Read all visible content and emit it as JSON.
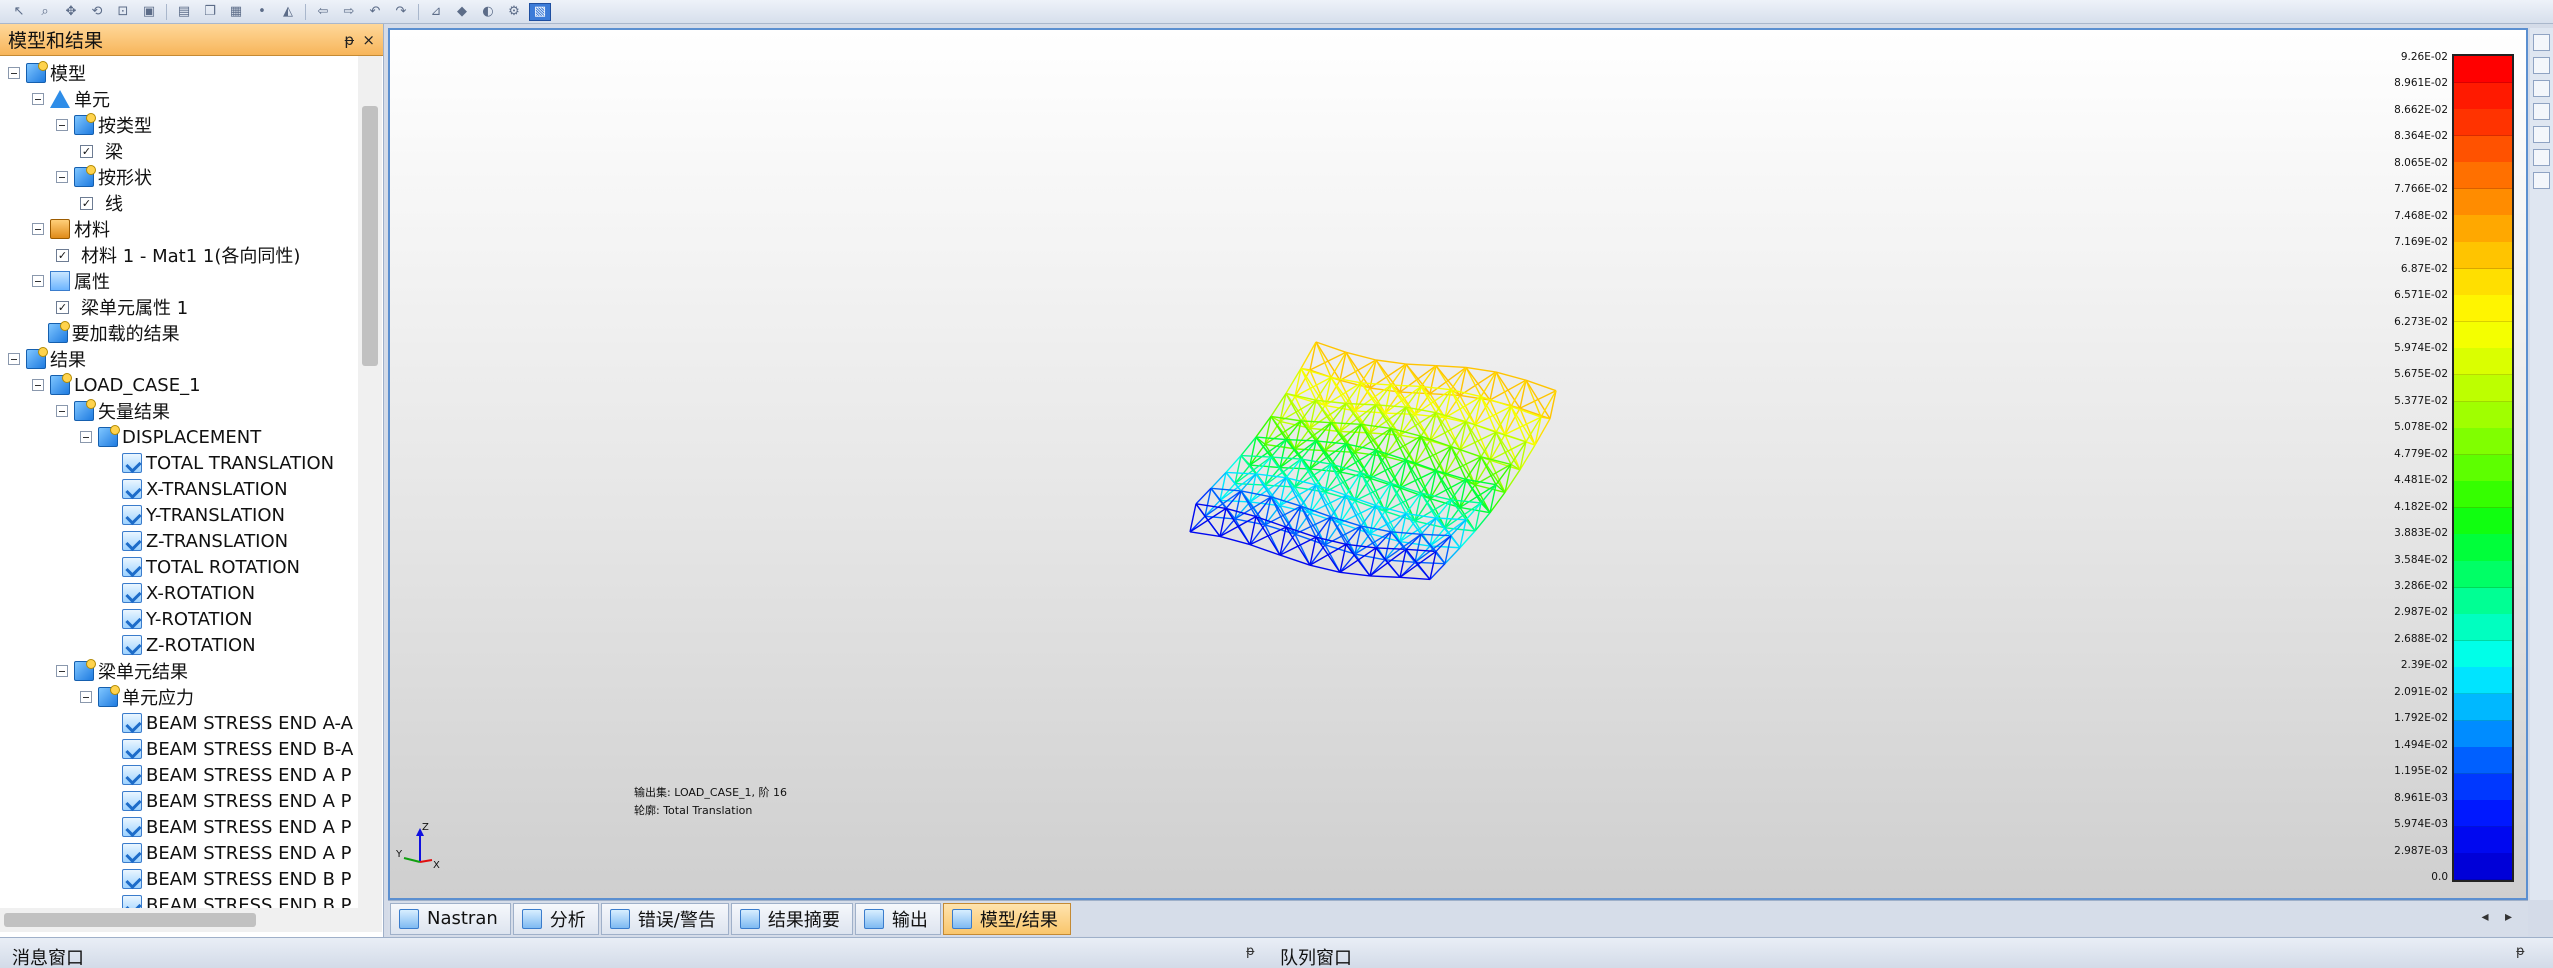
{
  "toolbar": {
    "icons": [
      "select-icon",
      "zoom-icon",
      "pan-icon",
      "rotate-icon",
      "fit-icon",
      "view-icon",
      "save-icon",
      "copy-icon",
      "mesh-icon",
      "node-icon",
      "element-icon",
      "arrow-left-icon",
      "arrow-right-icon",
      "undo-icon",
      "redo-icon",
      "measure-icon",
      "results-icon",
      "display-icon",
      "settings-icon",
      "active-view-icon"
    ]
  },
  "left_panel": {
    "title": "模型和结果",
    "pin_glyph": "ᵽ",
    "close_glyph": "×",
    "tree": [
      {
        "label": "模型",
        "level": 0,
        "icon": "folder",
        "expander": true
      },
      {
        "label": "单元",
        "level": 1,
        "icon": "element",
        "expander": true
      },
      {
        "label": "按类型",
        "level": 2,
        "icon": "folder",
        "expander": true
      },
      {
        "label": "梁",
        "level": 3,
        "icon": "none",
        "checkbox": true
      },
      {
        "label": "按形状",
        "level": 2,
        "icon": "folder",
        "expander": true
      },
      {
        "label": "线",
        "level": 3,
        "icon": "none",
        "checkbox": true
      },
      {
        "label": "材料",
        "level": 1,
        "icon": "mat",
        "expander": true
      },
      {
        "label": "材料 1 - Mat1 1(各向同性)",
        "level": 2,
        "icon": "none",
        "checkbox": true
      },
      {
        "label": "属性",
        "level": 1,
        "icon": "prop",
        "expander": true
      },
      {
        "label": "梁单元属性 1",
        "level": 2,
        "icon": "none",
        "checkbox": true
      },
      {
        "label": "要加载的结果",
        "level": 0.9,
        "icon": "folder",
        "expander": false
      },
      {
        "label": "结果",
        "level": 0,
        "icon": "folder",
        "expander": true
      },
      {
        "label": "LOAD_CASE_1",
        "level": 1,
        "icon": "folder",
        "expander": true
      },
      {
        "label": "矢量结果",
        "level": 2,
        "icon": "folder",
        "expander": true
      },
      {
        "label": "DISPLACEMENT",
        "level": 3,
        "icon": "folder",
        "expander": true
      },
      {
        "label": "TOTAL TRANSLATION",
        "level": 4,
        "icon": "result"
      },
      {
        "label": "X-TRANSLATION",
        "level": 4,
        "icon": "result"
      },
      {
        "label": "Y-TRANSLATION",
        "level": 4,
        "icon": "result"
      },
      {
        "label": "Z-TRANSLATION",
        "level": 4,
        "icon": "result"
      },
      {
        "label": "TOTAL ROTATION",
        "level": 4,
        "icon": "result"
      },
      {
        "label": "X-ROTATION",
        "level": 4,
        "icon": "result"
      },
      {
        "label": "Y-ROTATION",
        "level": 4,
        "icon": "result"
      },
      {
        "label": "Z-ROTATION",
        "level": 4,
        "icon": "result"
      },
      {
        "label": "梁单元结果",
        "level": 2,
        "icon": "folder",
        "expander": true
      },
      {
        "label": "单元应力",
        "level": 3,
        "icon": "folder",
        "expander": true
      },
      {
        "label": "BEAM STRESS END A-A",
        "level": 4,
        "icon": "result"
      },
      {
        "label": "BEAM STRESS END B-A",
        "level": 4,
        "icon": "result"
      },
      {
        "label": "BEAM STRESS END A P",
        "level": 4,
        "icon": "result"
      },
      {
        "label": "BEAM STRESS END A P",
        "level": 4,
        "icon": "result"
      },
      {
        "label": "BEAM STRESS END A P",
        "level": 4,
        "icon": "result"
      },
      {
        "label": "BEAM STRESS END A P",
        "level": 4,
        "icon": "result"
      },
      {
        "label": "BEAM STRESS END B P",
        "level": 4,
        "icon": "result"
      },
      {
        "label": "BEAM STRESS END B P",
        "level": 4,
        "icon": "result"
      }
    ]
  },
  "viewport": {
    "output_set_line": "输出集: LOAD_CASE_1, 阶 16",
    "contour_line": "轮廓: Total Translation",
    "triad": {
      "x": "X",
      "y": "Y",
      "z": "Z"
    },
    "legend": {
      "labels": [
        "9.26E-02",
        "8.961E-02",
        "8.662E-02",
        "8.364E-02",
        "8.065E-02",
        "7.766E-02",
        "7.468E-02",
        "7.169E-02",
        "6.87E-02",
        "6.571E-02",
        "6.273E-02",
        "5.974E-02",
        "5.675E-02",
        "5.377E-02",
        "5.078E-02",
        "4.779E-02",
        "4.481E-02",
        "4.182E-02",
        "3.883E-02",
        "3.584E-02",
        "3.286E-02",
        "2.987E-02",
        "2.688E-02",
        "2.39E-02",
        "2.091E-02",
        "1.792E-02",
        "1.494E-02",
        "1.195E-02",
        "8.961E-03",
        "5.974E-03",
        "2.987E-03",
        "0.0"
      ],
      "colors": [
        "#ff0000",
        "#ff1a00",
        "#ff3300",
        "#ff5200",
        "#ff7000",
        "#ff8c00",
        "#ffa800",
        "#ffc400",
        "#ffdf00",
        "#fff500",
        "#f4ff00",
        "#daff00",
        "#bdff00",
        "#a0ff00",
        "#80ff00",
        "#5dff00",
        "#35ff00",
        "#10ff10",
        "#00ff3a",
        "#00ff66",
        "#00ff94",
        "#00ffc0",
        "#00ffe8",
        "#00e4ff",
        "#00b8ff",
        "#008cff",
        "#0060ff",
        "#0038ff",
        "#0018ff",
        "#0008f0",
        "#0000d8"
      ]
    }
  },
  "tabs": [
    {
      "label": "Nastran",
      "active": false
    },
    {
      "label": "分析",
      "active": false
    },
    {
      "label": "错误/警告",
      "active": false
    },
    {
      "label": "结果摘要",
      "active": false
    },
    {
      "label": "输出",
      "active": false
    },
    {
      "label": "模型/结果",
      "active": true
    }
  ],
  "tab_nav": "◂ ▸",
  "bottom": {
    "messages_title": "消息窗口",
    "queue_title": "队列窗口",
    "pin_glyph": "ᵽ"
  }
}
